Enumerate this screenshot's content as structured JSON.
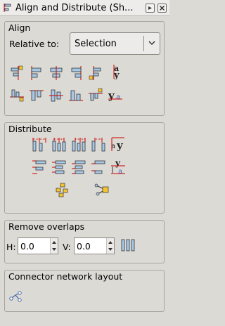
{
  "title": "Align and Distribute (Sh...",
  "align": {
    "heading": "Align",
    "relative_label": "Relative to:",
    "relative_value": "Selection"
  },
  "distribute": {
    "heading": "Distribute"
  },
  "overlaps": {
    "heading": "Remove overlaps",
    "h_label": "H:",
    "h_value": "0.0",
    "v_label": "V:",
    "v_value": "0.0"
  },
  "connector": {
    "heading": "Connector network layout"
  },
  "colors": {
    "accent": "#cc0000",
    "box_fill": "#a8c8e8",
    "node_fill": "#f4c430"
  }
}
